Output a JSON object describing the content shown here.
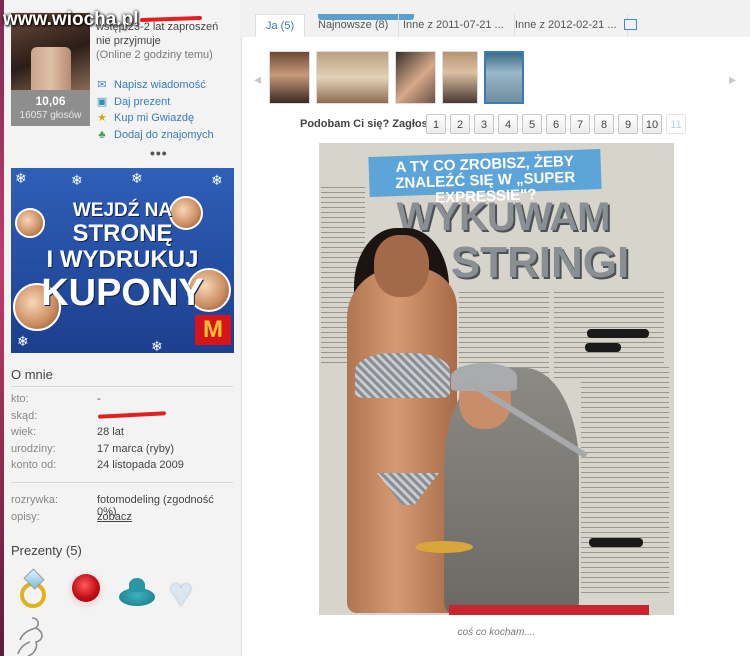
{
  "site": {
    "logo": "www.wiocha.pl"
  },
  "profile": {
    "rating": "10,06",
    "votes": "16057 głosów",
    "status_line1": "wstęp 23-2 lat zaproszeń",
    "status_line2": "nie przyjmuje",
    "online": "(Online 2 godziny temu)"
  },
  "actions": [
    {
      "label": "Napisz wiadomość",
      "icon": "envelope-icon"
    },
    {
      "label": "Daj prezent",
      "icon": "gift-icon"
    },
    {
      "label": "Kup mi Gwiazdę",
      "icon": "star-icon"
    },
    {
      "label": "Dodaj do znajomych",
      "icon": "add-friend-icon"
    }
  ],
  "more": "•••",
  "ad": {
    "line1": "WEJDŹ NA",
    "line2": "STRONĘ",
    "line3": "I WYDRUKUJ",
    "line4": "KUPONY",
    "logo": "M"
  },
  "about": {
    "title": "O mnie",
    "fields": [
      {
        "label": "kto:",
        "value": "-"
      },
      {
        "label": "skąd:",
        "value": ""
      },
      {
        "label": "wiek:",
        "value": "28 lat"
      },
      {
        "label": "urodziny:",
        "value": "17 marca (ryby)"
      },
      {
        "label": "konto od:",
        "value": "24 listopada 2009"
      }
    ],
    "fields2": [
      {
        "label": "rozrywka:",
        "value": "fotomodeling (zgodność 0%)"
      },
      {
        "label": "opisy:",
        "value": "zobacz"
      }
    ]
  },
  "gifts": {
    "title": "Prezenty (5)"
  },
  "tabs": [
    {
      "label": "Ja (5)",
      "active": true
    },
    {
      "label": "Najnowsze (8)"
    },
    {
      "label": "Inne z 2011-07-21 ..."
    },
    {
      "label": "Inne z 2012-02-21 ..."
    }
  ],
  "vote": {
    "label": "Podobam Ci się? Zagłosuj:",
    "options": [
      "1",
      "2",
      "3",
      "4",
      "5",
      "6",
      "7",
      "8",
      "9",
      "10",
      "11"
    ]
  },
  "photo": {
    "caption": "coś co kocham....",
    "np_header": "A TY CO ZROBISZ, ŻEBY ZNALEŹĆ SIĘ W „SUPER EXPRESSIE\"?",
    "np_title1": "WYKUWAM",
    "np_title2": "STRINGI"
  },
  "colors": {
    "link": "#3a7bb8",
    "accent": "#5da4d8",
    "redact": "#e32020"
  }
}
